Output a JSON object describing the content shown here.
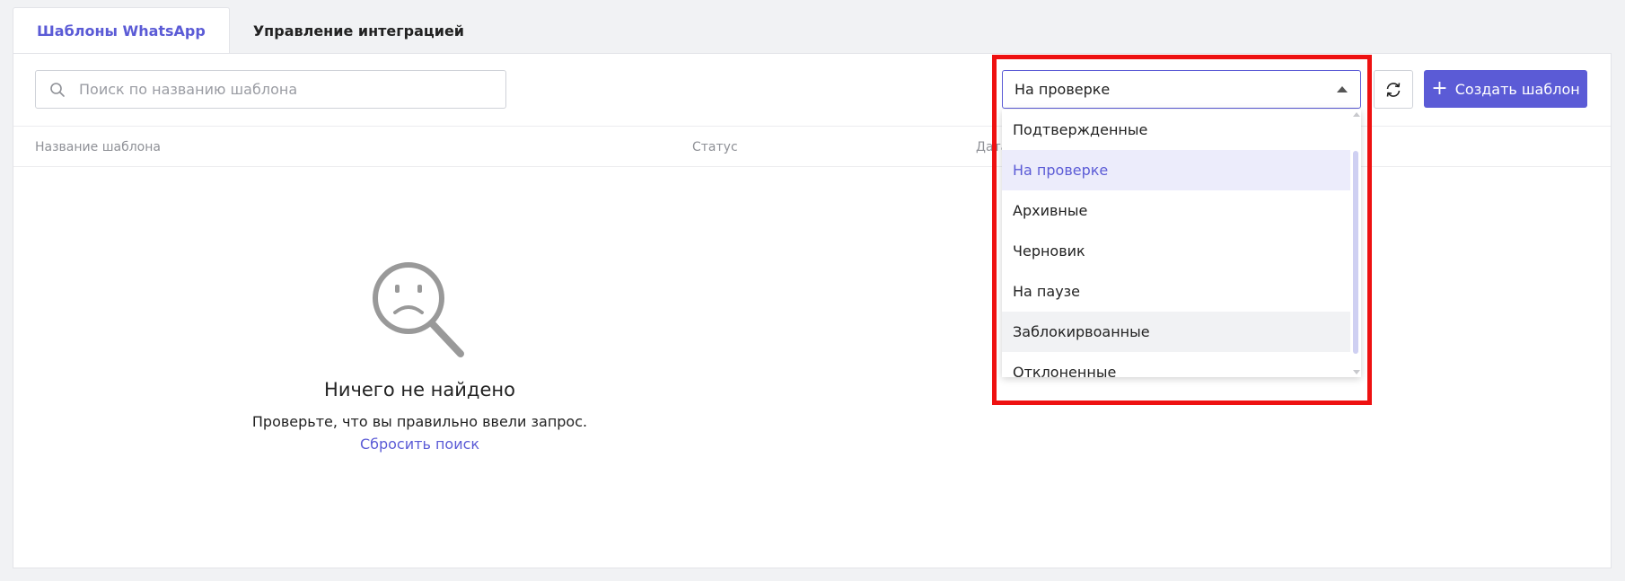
{
  "tabs": [
    {
      "label": "Шаблоны WhatsApp",
      "active": true
    },
    {
      "label": "Управление интеграцией",
      "active": false
    }
  ],
  "search": {
    "placeholder": "Поиск по названию шаблона",
    "value": ""
  },
  "table": {
    "columns": [
      "Название шаблона",
      "Статус",
      "Дата"
    ]
  },
  "empty_state": {
    "icon": "sad-magnifier-icon",
    "title": "Ничего не найдено",
    "text": "Проверьте, что вы правильно ввели запрос.",
    "reset_link": "Сбросить поиск"
  },
  "status_filter": {
    "selected": "На проверке",
    "options": [
      {
        "label": "Подтвержденные",
        "state": ""
      },
      {
        "label": "На проверке",
        "state": "selected"
      },
      {
        "label": "Архивные",
        "state": ""
      },
      {
        "label": "Черновик",
        "state": ""
      },
      {
        "label": "На паузе",
        "state": ""
      },
      {
        "label": "Заблокирвоанные",
        "state": "hover"
      },
      {
        "label": "Отклоненные",
        "state": ""
      }
    ]
  },
  "toolbar": {
    "refresh_icon": "refresh-icon",
    "create_label": "Создать шаблон",
    "create_icon": "plus-icon"
  },
  "colors": {
    "accent": "#5b5bd6",
    "highlight_border": "#ee1111",
    "selected_option_bg": "#ececfb"
  }
}
